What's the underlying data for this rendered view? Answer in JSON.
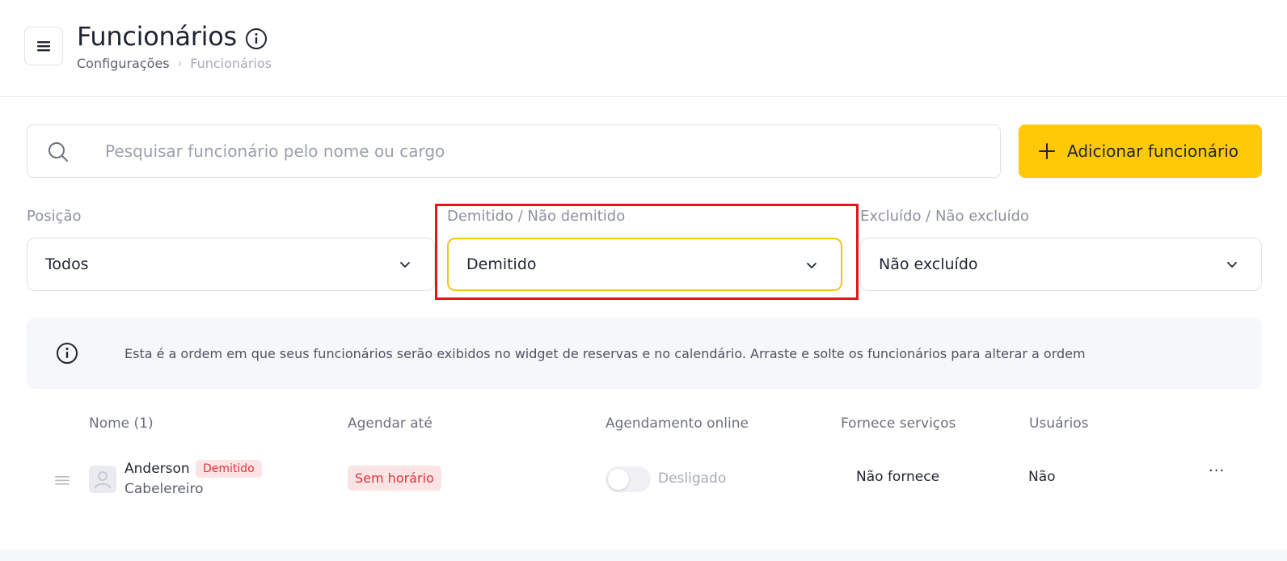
{
  "header": {
    "title": "Funcionários",
    "breadcrumb": [
      "Configurações",
      "Funcionários"
    ]
  },
  "search": {
    "placeholder": "Pesquisar funcionário pelo nome ou cargo",
    "value": ""
  },
  "add_button": {
    "label": "Adicionar funcionário"
  },
  "filters": [
    {
      "label": "Posição",
      "value": "Todos"
    },
    {
      "label": "Demitido / Não demitido",
      "value": "Demitido"
    },
    {
      "label": "Excluído / Não excluído",
      "value": "Não excluído"
    }
  ],
  "notice": {
    "text": "Esta é a ordem em que seus funcionários serão exibidos no widget de reservas e no calendário. Arraste e solte os funcionários para alterar a ordem"
  },
  "table": {
    "columns": [
      "Nome (1)",
      "Agendar até",
      "Agendamento online",
      "Fornece serviços",
      "Usuários"
    ],
    "rows": [
      {
        "name": "Anderson",
        "status_badge": "Demitido",
        "role": "Cabelereiro",
        "schedule_until": "Sem horário",
        "online_booking": "Desligado",
        "online_booking_on": false,
        "provides_services": "Não fornece",
        "users": "Não",
        "more": "···"
      }
    ]
  },
  "colors": {
    "accent": "#ffc905",
    "danger": "#e0323c",
    "danger_bg": "#fde4e4",
    "highlight": "#e8141b"
  },
  "icons": [
    "menu-icon",
    "info-icon",
    "search-icon",
    "plus-icon",
    "chevron-down-icon",
    "drag-handle-icon",
    "user-avatar-icon"
  ]
}
